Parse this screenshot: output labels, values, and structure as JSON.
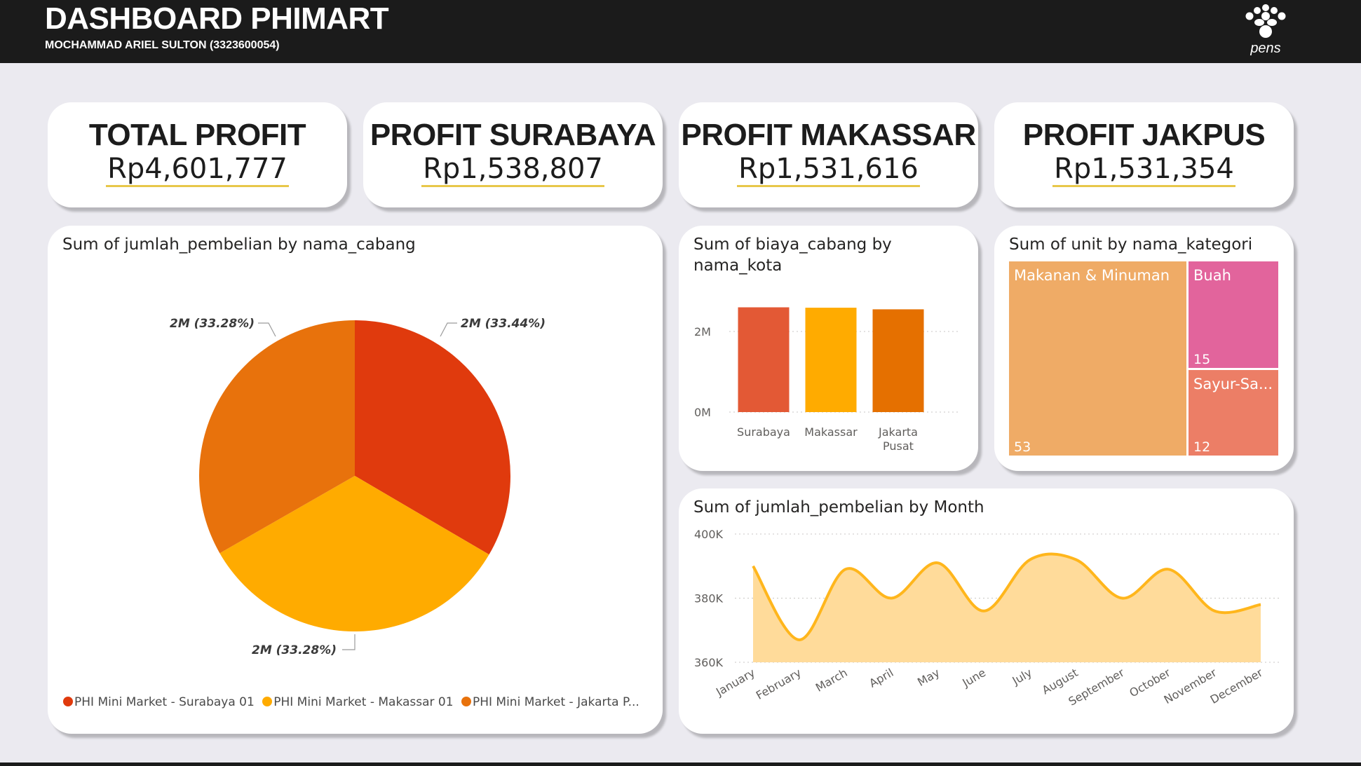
{
  "header": {
    "title": "DASHBOARD PHIMART",
    "subtitle": "MOCHAMMAD ARIEL SULTON (3323600054)",
    "logo_icon": "pens-logo-icon",
    "logo_text": "pens"
  },
  "kpis": [
    {
      "title": "TOTAL PROFIT",
      "value": "Rp4,601,777"
    },
    {
      "title": "PROFIT SURABAYA",
      "value": "Rp1,538,807"
    },
    {
      "title": "PROFIT MAKASSAR",
      "value": "Rp1,531,616"
    },
    {
      "title": "PROFIT JAKPUS",
      "value": "Rp1,531,354"
    }
  ],
  "pie": {
    "title": "Sum of jumlah_pembelian by nama_cabang",
    "labels": [
      "2M (33.44%)",
      "2M (33.28%)",
      "2M (33.28%)"
    ],
    "legend": [
      {
        "label": "PHI Mini Market - Surabaya 01",
        "color": "#e03a0d"
      },
      {
        "label": "PHI Mini Market - Makassar 01",
        "color": "#ffab00"
      },
      {
        "label": "PHI Mini Market - Jakarta P...",
        "color": "#e8720c"
      }
    ]
  },
  "bar": {
    "title": "Sum of biaya_cabang by nama_kota",
    "yticks": [
      "2M",
      "0M"
    ],
    "categories": [
      "Surabaya",
      "Makassar",
      "Jakarta Pusat"
    ],
    "cat_lines": [
      [
        "Surabaya"
      ],
      [
        "Makassar"
      ],
      [
        "Jakarta",
        "Pusat"
      ]
    ]
  },
  "treemap": {
    "title": "Sum of unit by nama_kategori",
    "items": [
      {
        "label": "Makanan & Minuman",
        "value": "53",
        "color": "#efab66"
      },
      {
        "label": "Buah",
        "value": "15",
        "color": "#e2649c"
      },
      {
        "label": "Sayur-Sa...",
        "value": "12",
        "color": "#ec7e66"
      }
    ]
  },
  "line": {
    "title": "Sum of jumlah_pembelian by Month",
    "yticks": [
      "400K",
      "380K",
      "360K"
    ]
  },
  "chart_data": [
    {
      "type": "pie",
      "title": "Sum of jumlah_pembelian by nama_cabang",
      "categories": [
        "PHI Mini Market - Surabaya 01",
        "PHI Mini Market - Makassar 01",
        "PHI Mini Market - Jakarta P..."
      ],
      "values": [
        33.44,
        33.28,
        33.28
      ],
      "colors": [
        "#e03a0d",
        "#ffab00",
        "#e8720c"
      ],
      "legend": "bottom-left"
    },
    {
      "type": "bar",
      "title": "Sum of biaya_cabang by nama_kota",
      "categories": [
        "Surabaya",
        "Makassar",
        "Jakarta Pusat"
      ],
      "values": [
        2.6,
        2.59,
        2.55
      ],
      "unit": "M",
      "ylim": [
        0,
        3
      ],
      "colors": [
        "#e35935",
        "#ffab00",
        "#e57000"
      ],
      "grid": true
    },
    {
      "type": "treemap",
      "title": "Sum of unit by nama_kategori",
      "categories": [
        "Makanan & Minuman",
        "Buah",
        "Sayur-Sa..."
      ],
      "values": [
        53,
        15,
        12
      ]
    },
    {
      "type": "area",
      "title": "Sum of jumlah_pembelian by Month",
      "categories": [
        "January",
        "February",
        "March",
        "April",
        "May",
        "June",
        "July",
        "August",
        "September",
        "October",
        "November",
        "December"
      ],
      "values": [
        390,
        367,
        389,
        380,
        391,
        376,
        392,
        392,
        380,
        389,
        376,
        378
      ],
      "unit": "K",
      "ylim": [
        360,
        400
      ],
      "color": "#ffb61c",
      "fill": "#ffdb9a",
      "grid": true
    }
  ]
}
